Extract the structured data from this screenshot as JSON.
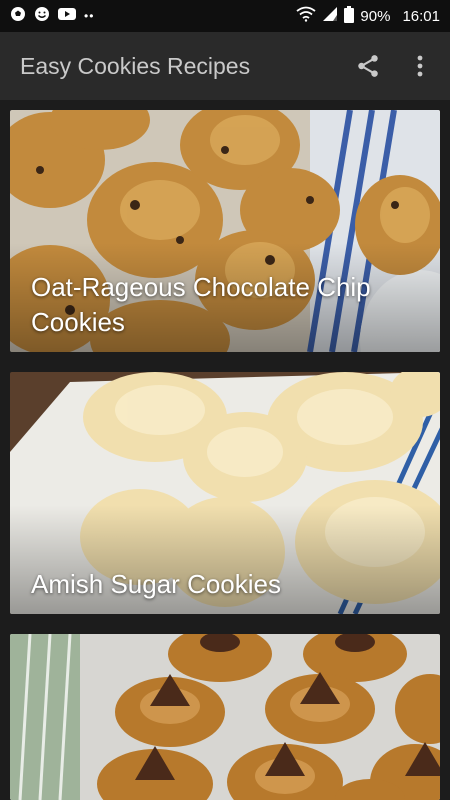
{
  "status_bar": {
    "battery": "90%",
    "time": "16:01",
    "left_icons": [
      "soccer-ball-icon",
      "smiley-icon",
      "youtube-icon",
      "more-dots-icon"
    ]
  },
  "app_bar": {
    "title": "Easy Cookies Recipes",
    "actions": [
      "share-icon",
      "overflow-menu-icon"
    ]
  },
  "recipes": [
    {
      "title": "Oat-Rageous Chocolate Chip Cookies"
    },
    {
      "title": "Amish Sugar Cookies"
    },
    {
      "title": ""
    }
  ],
  "colors": {
    "status_bar_bg": "#0f0f0f",
    "app_bar_bg": "#2a2a2a",
    "page_bg": "#1c1c1c",
    "title_text": "#c9c9c9"
  }
}
